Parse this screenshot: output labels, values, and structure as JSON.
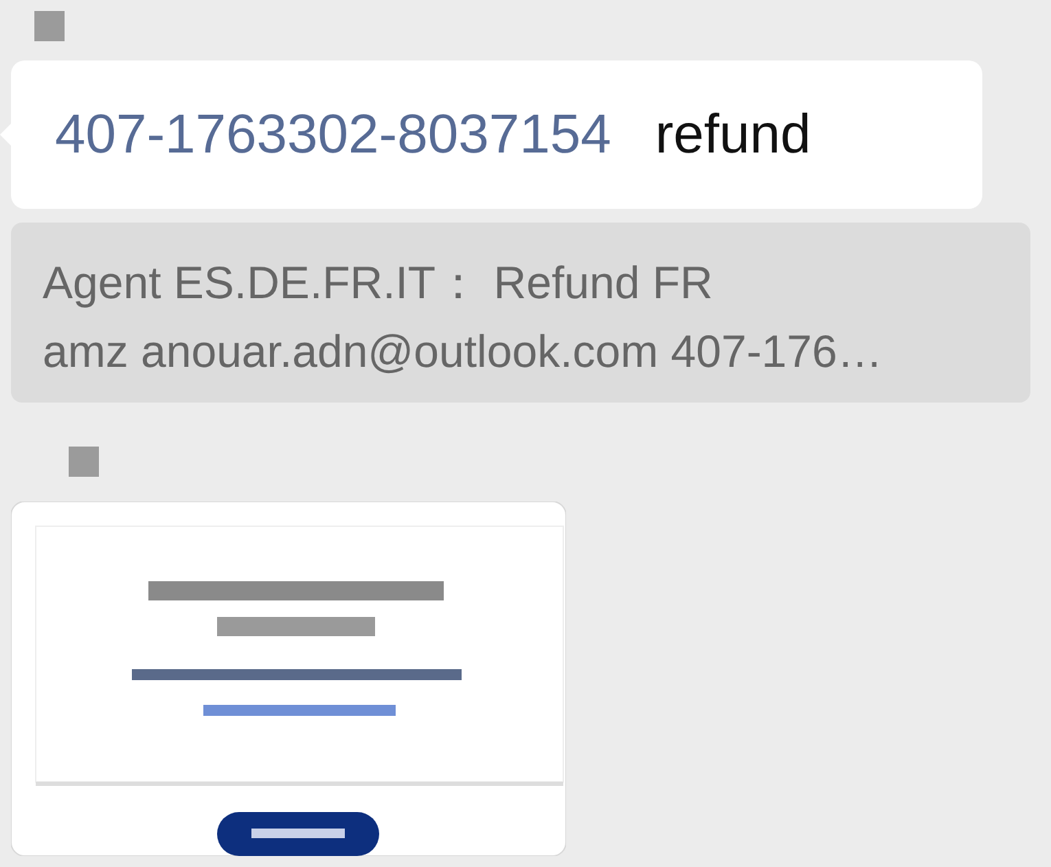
{
  "messages": [
    {
      "kind": "text",
      "link": "407-1763302-8037154",
      "text": "refund",
      "quote": {
        "lines": [
          "Agent ES.DE.FR.IT： Refund FR",
          "amz anouar.adn@outlook.com 407-176…"
        ]
      }
    },
    {
      "image": {
        "kind": "picture"
      }
    }
  ]
}
